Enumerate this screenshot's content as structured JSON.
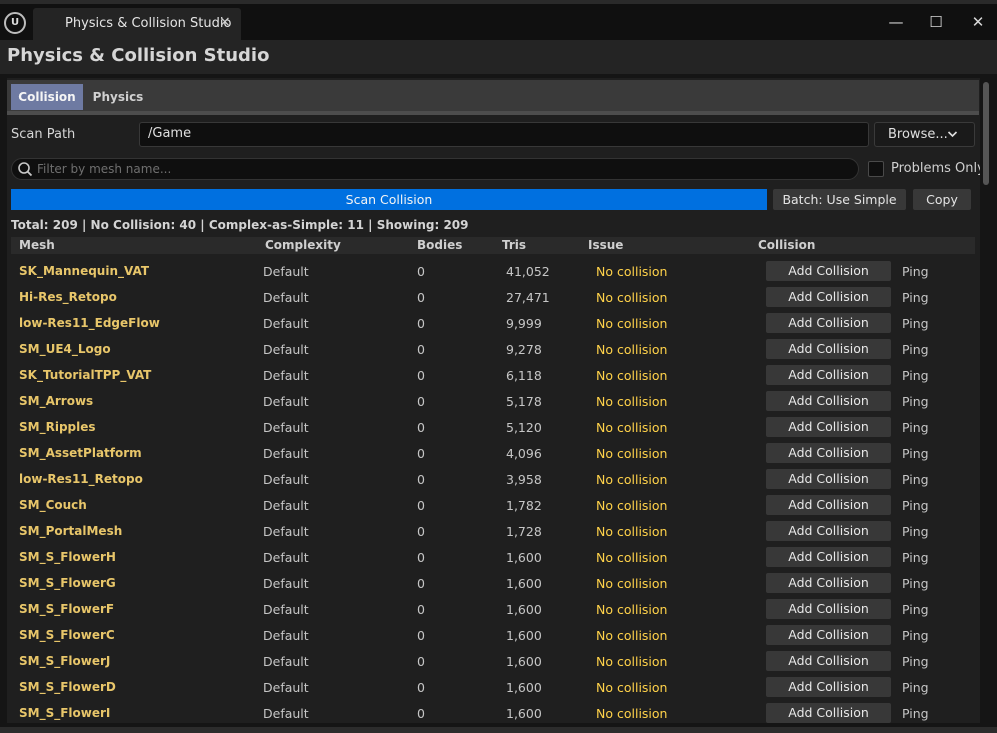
{
  "window": {
    "tab_title": "Physics & Collision Studio",
    "tab_close": "×",
    "logo_glyph": "U",
    "minimize": "—",
    "maximize": "☐",
    "close": "✕"
  },
  "app": {
    "title": "Physics & Collision Studio"
  },
  "tabs": [
    {
      "label": "Collision",
      "active": true
    },
    {
      "label": "Physics",
      "active": false
    }
  ],
  "scan": {
    "path_label": "Scan Path",
    "path_value": "/Game",
    "browse_label": "Browse...",
    "filter_placeholder": "Filter by mesh name...",
    "problems_only_label": "Problems Only",
    "scan_button": "Scan Collision",
    "batch_button": "Batch: Use Simple",
    "copy_button": "Copy"
  },
  "stats": "Total: 209  |  No Collision: 40  |  Complex-as-Simple: 11  |  Showing: 209",
  "columns": [
    "Mesh",
    "Complexity",
    "Bodies",
    "Tris",
    "Issue",
    "Collision"
  ],
  "row_actions": {
    "add": "Add Collision",
    "ping": "Ping"
  },
  "rows": [
    {
      "mesh": "SK_Mannequin_VAT",
      "complexity": "Default",
      "bodies": "0",
      "tris": "41,052",
      "issue": "No collision"
    },
    {
      "mesh": "Hi-Res_Retopo",
      "complexity": "Default",
      "bodies": "0",
      "tris": "27,471",
      "issue": "No collision"
    },
    {
      "mesh": "low-Res11_EdgeFlow",
      "complexity": "Default",
      "bodies": "0",
      "tris": "9,999",
      "issue": "No collision"
    },
    {
      "mesh": "SM_UE4_Logo",
      "complexity": "Default",
      "bodies": "0",
      "tris": "9,278",
      "issue": "No collision"
    },
    {
      "mesh": "SK_TutorialTPP_VAT",
      "complexity": "Default",
      "bodies": "0",
      "tris": "6,118",
      "issue": "No collision"
    },
    {
      "mesh": "SM_Arrows",
      "complexity": "Default",
      "bodies": "0",
      "tris": "5,178",
      "issue": "No collision"
    },
    {
      "mesh": "SM_Ripples",
      "complexity": "Default",
      "bodies": "0",
      "tris": "5,120",
      "issue": "No collision"
    },
    {
      "mesh": "SM_AssetPlatform",
      "complexity": "Default",
      "bodies": "0",
      "tris": "4,096",
      "issue": "No collision"
    },
    {
      "mesh": "low-Res11_Retopo",
      "complexity": "Default",
      "bodies": "0",
      "tris": "3,958",
      "issue": "No collision"
    },
    {
      "mesh": "SM_Couch",
      "complexity": "Default",
      "bodies": "0",
      "tris": "1,782",
      "issue": "No collision"
    },
    {
      "mesh": "SM_PortalMesh",
      "complexity": "Default",
      "bodies": "0",
      "tris": "1,728",
      "issue": "No collision"
    },
    {
      "mesh": "SM_S_FlowerH",
      "complexity": "Default",
      "bodies": "0",
      "tris": "1,600",
      "issue": "No collision"
    },
    {
      "mesh": "SM_S_FlowerG",
      "complexity": "Default",
      "bodies": "0",
      "tris": "1,600",
      "issue": "No collision"
    },
    {
      "mesh": "SM_S_FlowerF",
      "complexity": "Default",
      "bodies": "0",
      "tris": "1,600",
      "issue": "No collision"
    },
    {
      "mesh": "SM_S_FlowerC",
      "complexity": "Default",
      "bodies": "0",
      "tris": "1,600",
      "issue": "No collision"
    },
    {
      "mesh": "SM_S_FlowerJ",
      "complexity": "Default",
      "bodies": "0",
      "tris": "1,600",
      "issue": "No collision"
    },
    {
      "mesh": "SM_S_FlowerD",
      "complexity": "Default",
      "bodies": "0",
      "tris": "1,600",
      "issue": "No collision"
    },
    {
      "mesh": "SM_S_FlowerI",
      "complexity": "Default",
      "bodies": "0",
      "tris": "1,600",
      "issue": "No collision"
    }
  ],
  "colors": {
    "accent": "#0070e0",
    "active_tab": "#6e7aa2",
    "mesh_name": "#e8c66a",
    "issue": "#ffd24a"
  }
}
